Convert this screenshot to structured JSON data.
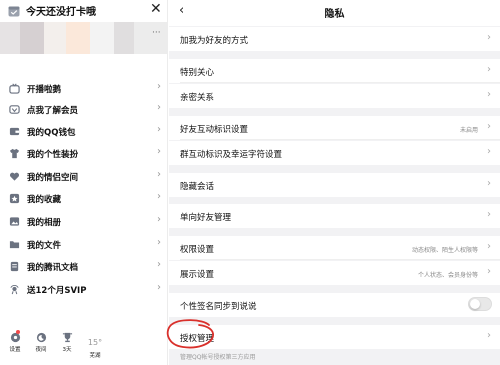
{
  "drawer": {
    "title": "今天还没打卡哦",
    "more": "···",
    "blur_colors": [
      "#e6e3e4",
      "#d6d0d2",
      "#f3efec",
      "#fbe8da",
      "#f3f3f3",
      "#e0dedf",
      "#ececec"
    ],
    "menu": [
      {
        "label": "开播啦鹅",
        "icon": "broadcast-icon"
      },
      {
        "label": "点我了解会员",
        "icon": "vip-icon"
      },
      {
        "label": "我的QQ钱包",
        "icon": "wallet-icon"
      },
      {
        "label": "我的个性装扮",
        "icon": "shirt-icon"
      },
      {
        "label": "我的情侣空间",
        "icon": "heart-icon"
      },
      {
        "label": "我的收藏",
        "icon": "star-icon"
      },
      {
        "label": "我的相册",
        "icon": "photo-icon"
      },
      {
        "label": "我的文件",
        "icon": "folder-icon"
      },
      {
        "label": "我的腾讯文档",
        "icon": "doc-icon"
      },
      {
        "label": "送12个月SVIP",
        "icon": "gift-icon"
      }
    ],
    "bottom": {
      "settings": "设置",
      "night": "夜间",
      "days": "3天",
      "temp": "15°",
      "city": "芜湖"
    }
  },
  "panel": {
    "title": "隐私",
    "rows": [
      {
        "label": "加我为好友的方式"
      },
      {
        "label": "特别关心"
      },
      {
        "label": "亲密关系"
      },
      {
        "label": "好友互动标识设置",
        "value": "未启用"
      },
      {
        "label": "群互动标识及幸运字符设置"
      },
      {
        "label": "隐藏会话"
      },
      {
        "label": "单向好友管理"
      },
      {
        "label": "权限设置",
        "value": "动态权限、陌生人权限等"
      },
      {
        "label": "展示设置",
        "value": "个人状态、会员身份等"
      },
      {
        "label": "个性签名同步到说说"
      },
      {
        "label": "授权管理"
      }
    ],
    "footnote": "管理QQ帐号授权第三方应用"
  },
  "colors": {
    "annotation": "#d9302b",
    "bg": "#f2f2f4"
  }
}
